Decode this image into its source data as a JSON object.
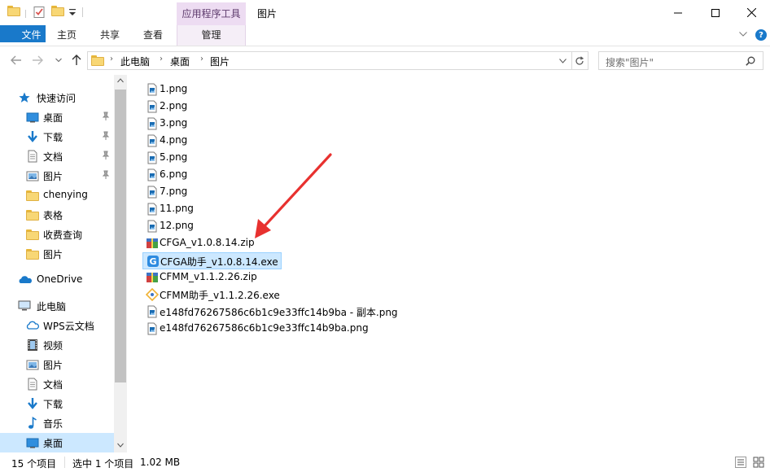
{
  "window": {
    "title": "图片",
    "context_tab_header": "应用程序工具"
  },
  "ribbon": {
    "tabs": [
      {
        "label": "文件"
      },
      {
        "label": "主页"
      },
      {
        "label": "共享"
      },
      {
        "label": "查看"
      },
      {
        "label": "管理"
      }
    ]
  },
  "address": {
    "breadcrumbs": [
      "此电脑",
      "桌面",
      "图片"
    ]
  },
  "search": {
    "placeholder": "搜索\"图片\""
  },
  "nav": {
    "quick_access": "快速访问",
    "quick_items": [
      {
        "label": "桌面",
        "icon": "desktop-icon",
        "pinned": true
      },
      {
        "label": "下载",
        "icon": "download-icon",
        "pinned": true
      },
      {
        "label": "文档",
        "icon": "document-icon",
        "pinned": true
      },
      {
        "label": "图片",
        "icon": "pictures-icon",
        "pinned": true
      },
      {
        "label": "chenying",
        "icon": "folder-icon",
        "pinned": false
      },
      {
        "label": "表格",
        "icon": "folder-icon",
        "pinned": false
      },
      {
        "label": "收费查询",
        "icon": "folder-icon",
        "pinned": false
      },
      {
        "label": "图片",
        "icon": "folder-icon",
        "pinned": false
      }
    ],
    "onedrive": "OneDrive",
    "this_pc": "此电脑",
    "pc_items": [
      {
        "label": "WPS云文档",
        "icon": "cloud-icon"
      },
      {
        "label": "视频",
        "icon": "video-icon"
      },
      {
        "label": "图片",
        "icon": "pictures-icon"
      },
      {
        "label": "文档",
        "icon": "document-icon"
      },
      {
        "label": "下载",
        "icon": "download-icon"
      },
      {
        "label": "音乐",
        "icon": "music-icon"
      },
      {
        "label": "桌面",
        "icon": "desktop-icon",
        "selected": true
      }
    ]
  },
  "files": [
    {
      "name": "1.png",
      "type": "png"
    },
    {
      "name": "2.png",
      "type": "png"
    },
    {
      "name": "3.png",
      "type": "png"
    },
    {
      "name": "4.png",
      "type": "png"
    },
    {
      "name": "5.png",
      "type": "png"
    },
    {
      "name": "6.png",
      "type": "png"
    },
    {
      "name": "7.png",
      "type": "png"
    },
    {
      "name": "11.png",
      "type": "png"
    },
    {
      "name": "12.png",
      "type": "png"
    },
    {
      "name": "CFGA_v1.0.8.14.zip",
      "type": "zip"
    },
    {
      "name": "CFGA助手_v1.0.8.14.exe",
      "type": "exe-cfga",
      "selected": true
    },
    {
      "name": "CFMM_v1.1.2.26.zip",
      "type": "zip"
    },
    {
      "name": "CFMM助手_v1.1.2.26.exe",
      "type": "exe-cfmm"
    },
    {
      "name": "e148fd76267586c6b1c9e33ffc14b9ba - 副本.png",
      "type": "png"
    },
    {
      "name": "e148fd76267586c6b1c9e33ffc14b9ba.png",
      "type": "png"
    }
  ],
  "status": {
    "item_count": "15 个项目",
    "selection": "选中 1 个项目",
    "size": "1.02 MB"
  },
  "colors": {
    "accent": "#1979ca",
    "selection": "#cce8ff",
    "context_tab": "#eddcf2",
    "annotation_arrow": "#e8312f"
  }
}
